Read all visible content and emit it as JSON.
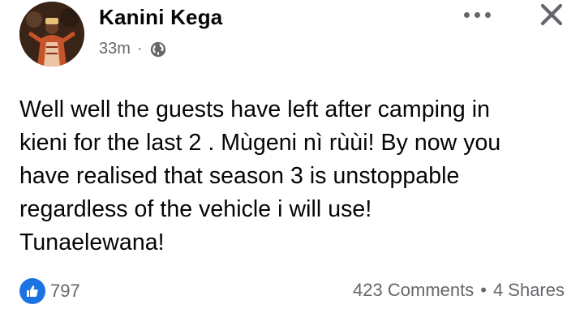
{
  "post": {
    "author": "Kanini Kega",
    "time": "33m",
    "separator": "·",
    "privacy_icon": "globe-icon",
    "text": "Well well the guests have left after camping in\nkieni for the last 2 . Mùgeni nì rùùi! By now you\nhave realised that season 3 is unstoppable\nregardless of the vehicle i will use!\nTunaelewana!",
    "reactions": {
      "icon": "like-icon",
      "count": "797"
    },
    "comments": "423 Comments",
    "dot": "•",
    "shares": "4 Shares"
  },
  "header_actions": {
    "more_icon": "more-horizontal-icon",
    "close_icon": "close-icon"
  },
  "colors": {
    "text": "#050505",
    "secondary": "#65676b",
    "like_blue": "#1b74e4"
  }
}
